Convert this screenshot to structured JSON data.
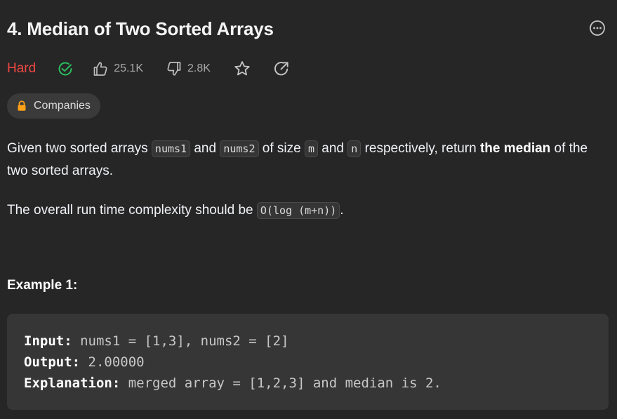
{
  "problem": {
    "title": "4. Median of Two Sorted Arrays",
    "difficulty": "Hard",
    "likes": "25.1K",
    "dislikes": "2.8K"
  },
  "companies_label": "Companies",
  "description": {
    "p1_a": "Given two sorted arrays ",
    "code_nums1": "nums1",
    "p1_b": " and ",
    "code_nums2": "nums2",
    "p1_c": " of size ",
    "code_m": "m",
    "p1_d": " and ",
    "code_n": "n",
    "p1_e": " respectively, return ",
    "p1_strong": "the median",
    "p1_f": " of the two sorted arrays.",
    "p2_a": "The overall run time complexity should be ",
    "code_complexity": "O(log (m+n))",
    "p2_b": "."
  },
  "example1": {
    "title": "Example 1:",
    "input_label": "Input:",
    "input_value": " nums1 = [1,3], nums2 = [2]",
    "output_label": "Output:",
    "output_value": " 2.00000",
    "explanation_label": "Explanation:",
    "explanation_value": " merged array = [1,2,3] and median is 2."
  },
  "colors": {
    "hard": "#ef4743",
    "solved": "#2cbb5d",
    "background": "#262626"
  }
}
